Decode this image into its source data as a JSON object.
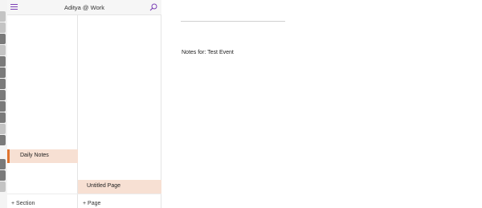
{
  "header": {
    "title": "Aditya @ Work",
    "menu_icon": "hamburger-icon",
    "search_icon": "search-icon"
  },
  "sections": {
    "items": [
      {
        "label": "Daily Notes",
        "selected": true,
        "color": "#e07530"
      }
    ],
    "add_label": "+ Section"
  },
  "pages": {
    "items": [
      {
        "label": "Untitled Page",
        "selected": true
      }
    ],
    "add_label": "+ Page"
  },
  "content": {
    "note_text": "Notes for: Test Event"
  },
  "colors": {
    "accent": "#7b3fb5",
    "selection_bg": "#f7e0d3",
    "section_marker": "#e07530"
  }
}
